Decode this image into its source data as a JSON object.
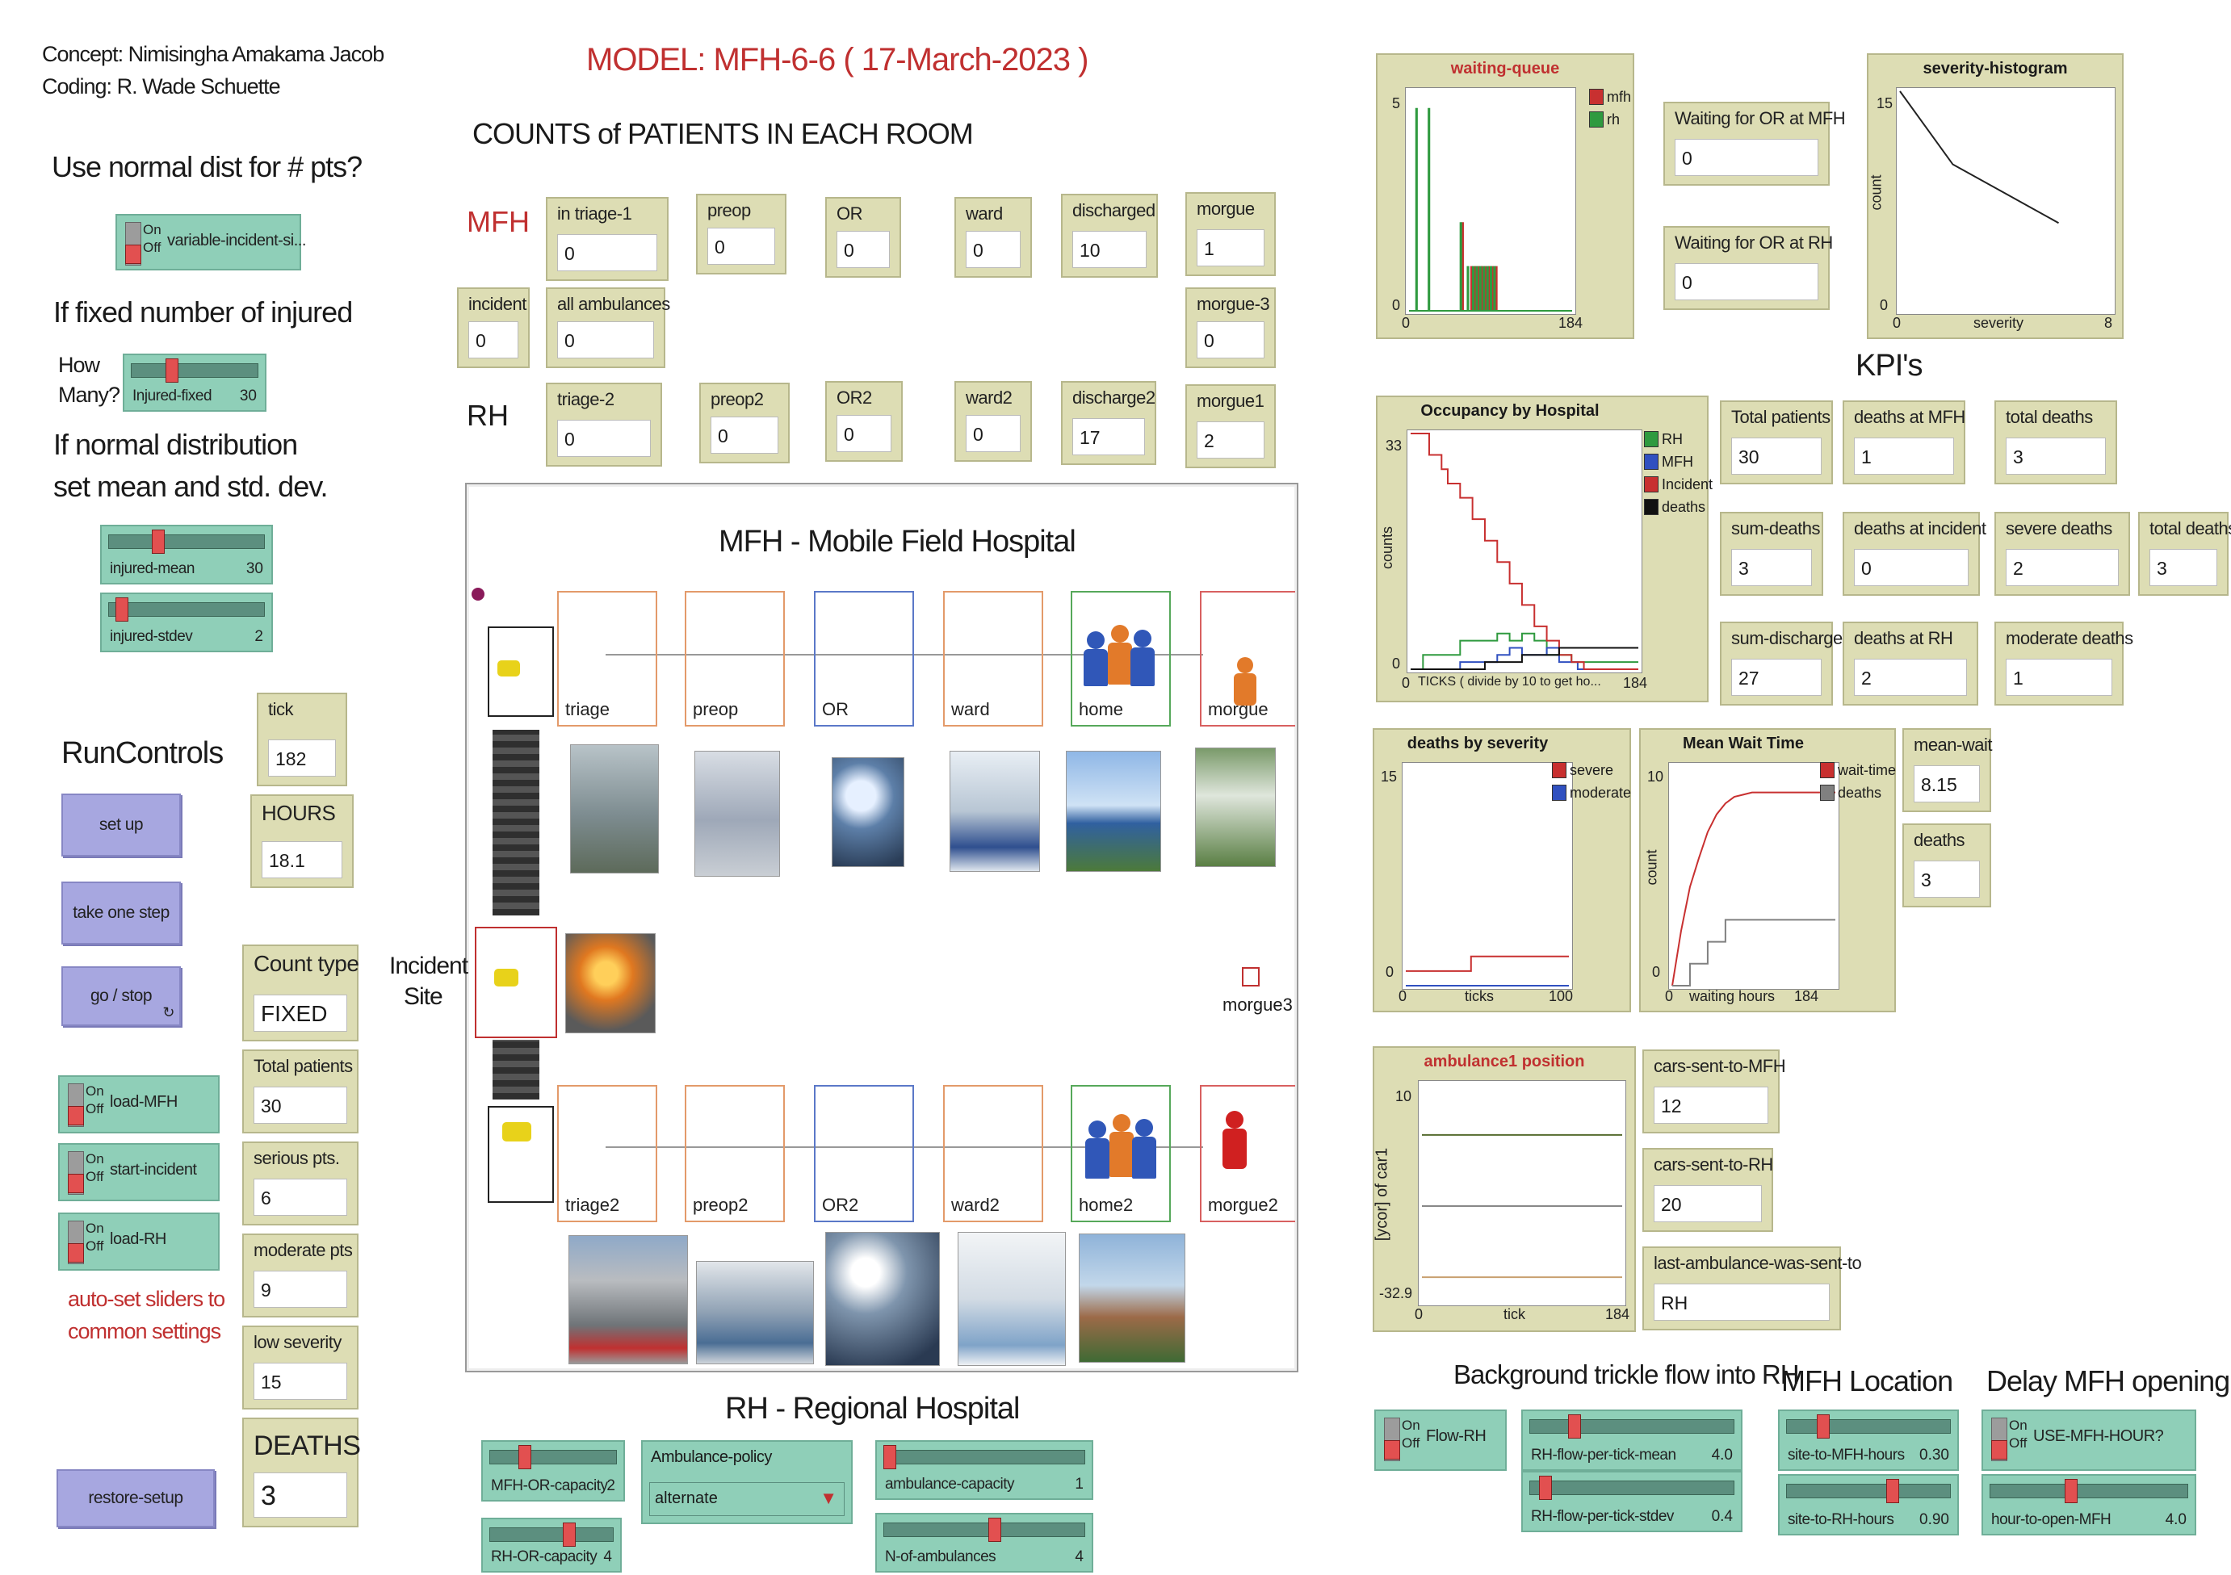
{
  "credits": {
    "concept": "Concept: Nimisingha Amakama Jacob",
    "coding": "Coding:   R. Wade Schuette"
  },
  "model_title": "MODEL: MFH-6-6 ( 17-March-2023 )",
  "counts_heading": "COUNTS of PATIENTS IN EACH ROOM",
  "labels": {
    "use_normal": "Use normal dist for # pts?",
    "fixed_injured": "If fixed number of injured",
    "how": "How",
    "many": "Many?",
    "normal_dist_1": "If normal distribution",
    "normal_dist_2": "set mean and std. dev.",
    "run_controls": "RunControls",
    "incident_site_1": "Incident",
    "incident_site_2": "Site",
    "auto_set_1": "auto-set sliders to",
    "auto_set_2": "common settings",
    "mfh_row": "MFH",
    "rh_row": "RH",
    "kpis": "KPI's",
    "background_trickle": "Background trickle flow into RH",
    "mfh_location": "MFH Location",
    "delay_mfh": "Delay MFH opening",
    "rh_regional": "RH - Regional Hospital",
    "mfh_mobile": "MFH - Mobile Field Hospital",
    "morgue3": "morgue3"
  },
  "switch_text": {
    "on": "On",
    "off": "Off"
  },
  "switches": {
    "variable_incident": "variable-incident-si...",
    "load_mfh": "load-MFH",
    "start_incident": "start-incident",
    "load_rh": "load-RH",
    "flow_rh": "Flow-RH",
    "use_mfh_hour": "USE-MFH-HOUR?"
  },
  "sliders": {
    "injured_fixed": {
      "name": "Injured-fixed",
      "value": "30",
      "fraction": 0.3
    },
    "injured_mean": {
      "name": "injured-mean",
      "value": "30",
      "fraction": 0.3
    },
    "injured_stdev": {
      "name": "injured-stdev",
      "value": "2",
      "fraction": 0.05
    },
    "mfh_or_capacity": {
      "name": "MFH-OR-capacity",
      "value": "2",
      "fraction": 0.25
    },
    "rh_or_capacity": {
      "name": "RH-OR-capacity",
      "value": "4",
      "fraction": 0.65
    },
    "ambulance_capacity": {
      "name": "ambulance-capacity",
      "value": "1",
      "fraction": 0.0
    },
    "n_of_ambulances": {
      "name": "N-of-ambulances",
      "value": "4",
      "fraction": 0.55
    },
    "rh_flow_mean": {
      "name": "RH-flow-per-tick-mean",
      "value": "4.0",
      "fraction": 0.2
    },
    "rh_flow_stdev": {
      "name": "RH-flow-per-tick-stdev",
      "value": "0.4",
      "fraction": 0.05
    },
    "site_to_mfh": {
      "name": "site-to-MFH-hours",
      "value": "0.30",
      "fraction": 0.2
    },
    "site_to_rh": {
      "name": "site-to-RH-hours",
      "value": "0.90",
      "fraction": 0.65
    },
    "hour_to_open": {
      "name": "hour-to-open-MFH",
      "value": "4.0",
      "fraction": 0.4
    }
  },
  "buttons": {
    "setup": "set up",
    "take_one_step": "take one step",
    "go_stop": "go / stop",
    "restore_setup": "restore-setup"
  },
  "chooser": {
    "name": "Ambulance-policy",
    "value": "alternate"
  },
  "monitors": {
    "in_triage_1": {
      "title": "in triage-1",
      "value": "0"
    },
    "preop": {
      "title": "preop",
      "value": "0"
    },
    "or": {
      "title": "OR",
      "value": "0"
    },
    "ward": {
      "title": "ward",
      "value": "0"
    },
    "discharged": {
      "title": "discharged",
      "value": "10"
    },
    "morgue": {
      "title": "morgue",
      "value": "1"
    },
    "incident": {
      "title": "incident",
      "value": "0"
    },
    "all_ambulances": {
      "title": "all ambulances",
      "value": "0"
    },
    "morgue_3": {
      "title": "morgue-3",
      "value": "0"
    },
    "triage_2": {
      "title": "triage-2",
      "value": "0"
    },
    "preop2": {
      "title": "preop2",
      "value": "0"
    },
    "or2": {
      "title": "OR2",
      "value": "0"
    },
    "ward2": {
      "title": "ward2",
      "value": "0"
    },
    "discharge2": {
      "title": "discharge2",
      "value": "17"
    },
    "morgue1": {
      "title": "morgue1",
      "value": "2"
    },
    "tick": {
      "title": "tick",
      "value": "182"
    },
    "hours": {
      "title": "HOURS",
      "value": "18.1"
    },
    "count_type": {
      "title": "Count type",
      "value": "FIXED"
    },
    "total_patients_left": {
      "title": "Total patients",
      "value": "30"
    },
    "serious_pts": {
      "title": "serious pts.",
      "value": "6"
    },
    "moderate_pts": {
      "title": "moderate pts",
      "value": "9"
    },
    "low_severity": {
      "title": "low severity",
      "value": "15"
    },
    "deaths_big": {
      "title": "DEATHS",
      "value": "3"
    },
    "waiting_or_mfh": {
      "title": "Waiting for OR at MFH",
      "value": "0"
    },
    "waiting_or_rh": {
      "title": "Waiting for OR at RH",
      "value": "0"
    },
    "kpi_total_patients": {
      "title": "Total patients",
      "value": "30"
    },
    "kpi_deaths_mfh": {
      "title": "deaths at MFH",
      "value": "1"
    },
    "kpi_total_deaths": {
      "title": "total deaths",
      "value": "3"
    },
    "kpi_sum_deaths": {
      "title": "sum-deaths",
      "value": "3"
    },
    "kpi_deaths_incident": {
      "title": "deaths at incident",
      "value": "0"
    },
    "kpi_severe_deaths": {
      "title": "severe deaths",
      "value": "2"
    },
    "kpi_total_deaths_2": {
      "title": "total deaths",
      "value": "3"
    },
    "kpi_sum_discharges": {
      "title": "sum-discharges",
      "value": "27"
    },
    "kpi_deaths_rh": {
      "title": "deaths at RH",
      "value": "2"
    },
    "kpi_moderate_deaths": {
      "title": "moderate deaths",
      "value": "1"
    },
    "mean_wait": {
      "title": "mean-wait",
      "value": "8.15"
    },
    "deaths_small": {
      "title": "deaths",
      "value": "3"
    },
    "cars_sent_mfh": {
      "title": "cars-sent-to-MFH",
      "value": "12"
    },
    "cars_sent_rh": {
      "title": "cars-sent-to-RH",
      "value": "20"
    },
    "last_ambulance": {
      "title": "last-ambulance-was-sent-to",
      "value": "RH"
    }
  },
  "rooms_top": [
    "triage",
    "preop",
    "OR",
    "ward",
    "home",
    "morgue"
  ],
  "rooms_bottom": [
    "triage2",
    "preop2",
    "OR2",
    "ward2",
    "home2",
    "morgue2"
  ],
  "colors": {
    "widget_bg": "#ddddb4",
    "button": "#a7a7e0",
    "switch": "#8fcfb8",
    "title_red": "#c03030",
    "mfh_series": "#2f9a3f",
    "rh_series": "#2f9a3f",
    "series_red": "#c83030",
    "series_blue": "#3050c0",
    "series_green": "#2f9a3f",
    "series_gray": "#808080"
  },
  "chart_data": [
    {
      "type": "line",
      "title": "waiting-queue",
      "x_ticks": [
        "0",
        "184"
      ],
      "y_ticks": [
        "0",
        "5"
      ],
      "xlim": [
        0,
        184
      ],
      "ylim": [
        0,
        5
      ],
      "series": [
        {
          "name": "mfh",
          "color": "#c83030",
          "x": [
            0,
            60,
            60,
            61,
            61,
            70,
            70,
            71,
            71,
            74,
            74,
            75,
            75,
            78,
            78,
            79,
            79,
            82,
            82,
            83,
            83,
            86,
            86,
            87,
            87,
            90,
            90,
            91,
            91,
            94,
            94,
            95,
            95,
            98,
            98,
            99,
            99,
            184
          ],
          "y": [
            0,
            0,
            2,
            2,
            0,
            0,
            1,
            1,
            0,
            0,
            1,
            1,
            0,
            0,
            1,
            1,
            0,
            0,
            1,
            1,
            0,
            0,
            1,
            1,
            0,
            0,
            1,
            1,
            0,
            0,
            1,
            1,
            0,
            0,
            1,
            1,
            0,
            0
          ]
        },
        {
          "name": "rh",
          "color": "#2f9a3f",
          "x": [
            0,
            8,
            8,
            9,
            9,
            22,
            22,
            23,
            23,
            58,
            58,
            59,
            59,
            66,
            66,
            67,
            67,
            72,
            72,
            73,
            73,
            76,
            76,
            77,
            77,
            80,
            80,
            81,
            81,
            84,
            84,
            85,
            85,
            88,
            88,
            89,
            89,
            92,
            92,
            93,
            93,
            96,
            96,
            97,
            97,
            184
          ],
          "y": [
            0,
            0,
            4.6,
            4.6,
            0,
            0,
            4.6,
            4.6,
            0,
            0,
            2,
            2,
            0,
            0,
            1,
            1,
            0,
            0,
            1,
            1,
            0,
            0,
            1,
            1,
            0,
            0,
            1,
            1,
            0,
            0,
            1,
            1,
            0,
            0,
            1,
            1,
            0,
            0,
            1,
            1,
            0,
            0,
            1,
            1,
            0,
            0
          ]
        }
      ]
    },
    {
      "type": "line",
      "title": "severity-histogram",
      "xlabel": "severity",
      "ylabel": "count",
      "x_ticks": [
        "0",
        "8"
      ],
      "y_ticks": [
        "0",
        "15"
      ],
      "xlim": [
        0,
        8
      ],
      "ylim": [
        0,
        15
      ],
      "series": [
        {
          "color": "#222222",
          "x": [
            0,
            2,
            4,
            6
          ],
          "y": [
            15,
            10,
            8,
            6
          ]
        }
      ]
    },
    {
      "type": "line",
      "title": "Occupancy by Hospital",
      "xlabel": "TICKS  ( divide by 10 to get ho...",
      "ylabel": "counts",
      "x_ticks": [
        "0",
        "184"
      ],
      "y_ticks": [
        "0",
        "33"
      ],
      "xlim": [
        0,
        184
      ],
      "ylim": [
        0,
        33
      ],
      "series": [
        {
          "name": "RH",
          "color": "#2f9a3f",
          "x": [
            0,
            10,
            10,
            40,
            40,
            70,
            70,
            80,
            80,
            90,
            90,
            100,
            100,
            110,
            110,
            130,
            130,
            184
          ],
          "y": [
            0,
            0,
            2,
            2,
            4,
            4,
            5,
            5,
            4,
            4,
            5,
            5,
            4,
            4,
            2,
            2,
            1,
            1
          ]
        },
        {
          "name": "MFH",
          "color": "#3050c0",
          "x": [
            0,
            40,
            40,
            70,
            70,
            80,
            80,
            90,
            90,
            110,
            110,
            120,
            120,
            135,
            135,
            184
          ],
          "y": [
            0,
            0,
            1,
            1,
            2,
            2,
            3,
            3,
            2,
            2,
            3,
            3,
            1,
            1,
            0,
            0
          ]
        },
        {
          "name": "Incident",
          "color": "#c83030",
          "x": [
            0,
            15,
            15,
            25,
            25,
            30,
            30,
            40,
            40,
            50,
            50,
            60,
            60,
            70,
            70,
            80,
            80,
            90,
            90,
            100,
            100,
            110,
            110,
            120,
            120,
            130,
            130,
            140,
            140,
            184
          ],
          "y": [
            33,
            33,
            30,
            30,
            28,
            28,
            26,
            26,
            24,
            24,
            21,
            21,
            18,
            18,
            15,
            15,
            12,
            12,
            9,
            9,
            6,
            6,
            4,
            4,
            2,
            2,
            1,
            1,
            0,
            0
          ]
        },
        {
          "name": "deaths",
          "color": "#111111",
          "x": [
            0,
            60,
            60,
            90,
            90,
            120,
            120,
            184
          ],
          "y": [
            0,
            0,
            1,
            1,
            2,
            2,
            3,
            3
          ]
        }
      ]
    },
    {
      "type": "line",
      "title": "deaths by severity",
      "xlabel": "ticks",
      "x_ticks": [
        "0",
        "100"
      ],
      "y_ticks": [
        "0",
        "15"
      ],
      "xlim": [
        0,
        100
      ],
      "ylim": [
        0,
        15
      ],
      "series": [
        {
          "name": "severe",
          "color": "#c83030",
          "x": [
            0,
            40,
            40,
            100
          ],
          "y": [
            1,
            1,
            2,
            2
          ]
        },
        {
          "name": "moderate",
          "color": "#3050c0",
          "x": [
            0,
            100
          ],
          "y": [
            0,
            0
          ]
        }
      ]
    },
    {
      "type": "line",
      "title": "Mean Wait Time",
      "xlabel": "waiting hours",
      "ylabel": "count",
      "x_ticks": [
        "0",
        "184"
      ],
      "y_ticks": [
        "0",
        "10"
      ],
      "xlim": [
        0,
        184
      ],
      "ylim": [
        0,
        10
      ],
      "series": [
        {
          "name": "wait-time",
          "color": "#c83030",
          "x": [
            0,
            10,
            20,
            30,
            40,
            50,
            60,
            70,
            80,
            90,
            100,
            184
          ],
          "y": [
            0,
            2.5,
            4.5,
            5.8,
            7.0,
            7.8,
            8.3,
            8.6,
            8.7,
            8.8,
            8.8,
            8.8
          ]
        },
        {
          "name": "deaths",
          "color": "#808080",
          "x": [
            0,
            20,
            20,
            40,
            40,
            60,
            60,
            184
          ],
          "y": [
            0,
            0,
            1,
            1,
            2,
            2,
            3,
            3
          ]
        }
      ]
    },
    {
      "type": "line",
      "title": "ambulance1 position",
      "xlabel": "tick",
      "ylabel": "[ycor] of car1",
      "x_ticks": [
        "0",
        "184"
      ],
      "y_ticks": [
        "-32.9",
        "10"
      ],
      "xlim": [
        0,
        184
      ],
      "ylim": [
        -32.9,
        10
      ],
      "series": [
        {
          "color": "#556b2f",
          "x": [
            0,
            184
          ],
          "y": [
            0,
            0
          ]
        },
        {
          "color": "#888888",
          "x": [
            0,
            184
          ],
          "y": [
            -14,
            -14
          ]
        },
        {
          "color": "#c8a070",
          "x": [
            0,
            184
          ],
          "y": [
            -28,
            -28
          ]
        }
      ]
    }
  ]
}
